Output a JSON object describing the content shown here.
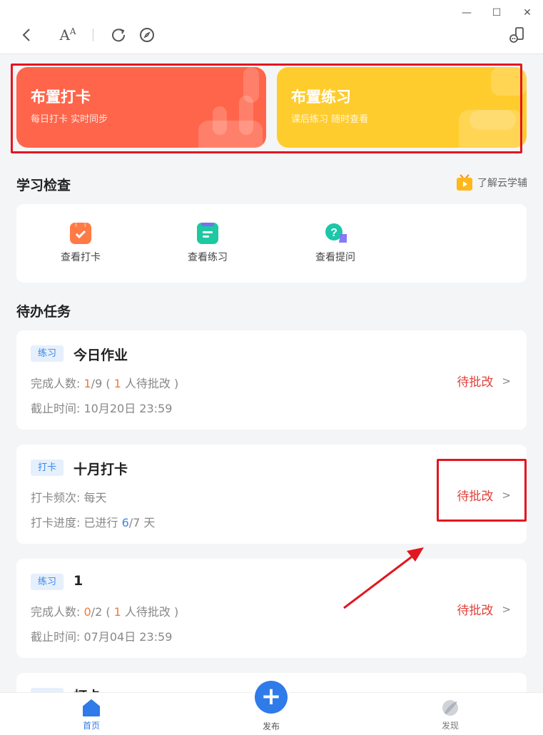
{
  "window": {
    "minimize": "—",
    "maximize": "☐",
    "close": "✕"
  },
  "toolbar": {
    "font_label": "A",
    "font_label_sup": "A"
  },
  "banners": [
    {
      "title": "布置打卡",
      "subtitle": "每日打卡  实时同步",
      "color": "#ff654a"
    },
    {
      "title": "布置练习",
      "subtitle": "课后练习  随时查看",
      "color": "#ffcc2e"
    }
  ],
  "study_check": {
    "title": "学习检查",
    "learn_more": "了解云学辅",
    "items": [
      {
        "label": "查看打卡",
        "icon": "calendar-check-icon",
        "color": "#ff7a45"
      },
      {
        "label": "查看练习",
        "icon": "document-icon",
        "color": "#1ec8a0"
      },
      {
        "label": "查看提问",
        "icon": "question-bubble-icon",
        "color": "#1cc7a8"
      }
    ]
  },
  "todo": {
    "title": "待办任务",
    "tasks": [
      {
        "tag": "练习",
        "title": "今日作业",
        "line1_label": "完成人数: ",
        "line1_num": "1",
        "line1_total": "/9 ( ",
        "line1_pending": "1",
        "line1_suffix": " 人待批改 )",
        "line2": "截止时间:  10月20日 23:59",
        "status": "待批改"
      },
      {
        "tag": "打卡",
        "title": "十月打卡",
        "line1": "打卡频次:  每天",
        "line2_label": "打卡进度:  已进行 ",
        "line2_num": "6",
        "line2_suffix": "/7 天",
        "status": "待批改"
      },
      {
        "tag": "练习",
        "title": "1",
        "line1_label": "完成人数: ",
        "line1_num": "0",
        "line1_total": "/2 ( ",
        "line1_pending": "1",
        "line1_suffix": " 人待批改 )",
        "line2": "截止时间:  07月04日 23:59",
        "status": "待批改"
      },
      {
        "tag": "",
        "title": "打卡"
      }
    ]
  },
  "bottom_nav": {
    "home": "首页",
    "publish": "发布",
    "discover": "发现"
  },
  "colors": {
    "accent": "#2f7bea",
    "danger": "#e0413a",
    "orange": "#f07a3a"
  }
}
